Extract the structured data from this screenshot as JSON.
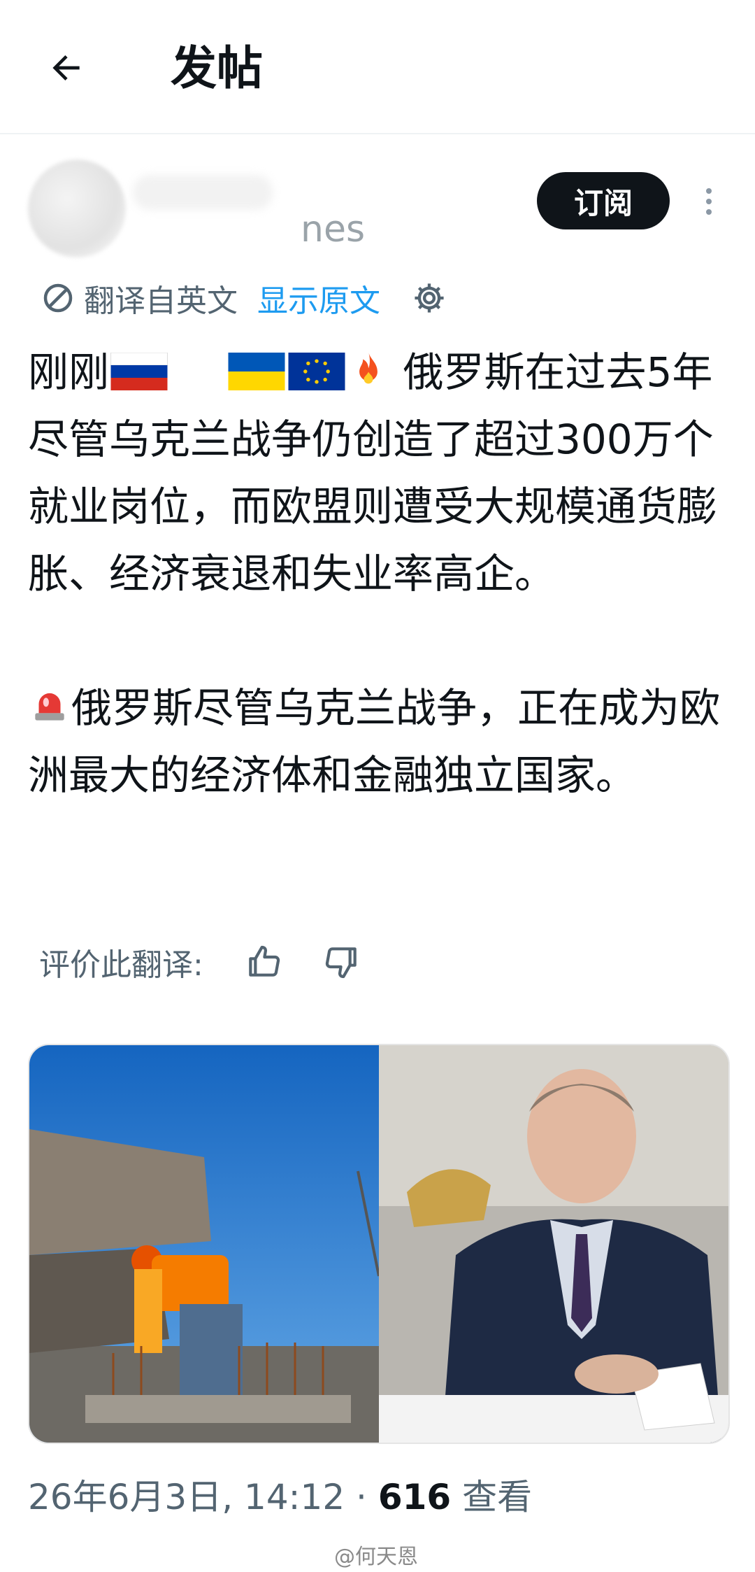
{
  "header": {
    "back_icon": "arrow-left-icon",
    "title": "发帖"
  },
  "author": {
    "handle_fragment": "nes",
    "subscribe_label": "订阅",
    "more_icon": "more-vertical-icon"
  },
  "translation": {
    "icon": "translate-icon",
    "label": "翻译自英文",
    "show_original": "显示原文",
    "settings_icon": "gear-icon"
  },
  "post": {
    "p1_lead": "刚刚",
    "p1_text": " 俄罗斯在过去5年尽管乌克兰战争仍创造了超过300万个就业岗位，而欧盟则遭受大规模通货膨胀、经济衰退和失业率高企。",
    "p2_text": "俄罗斯尽管乌克兰战争，正在成为欧洲最大的经济体和金融独立国家。",
    "emojis": [
      "russia-flag",
      "ukraine-flag",
      "eu-flag",
      "fire-emoji",
      "siren-emoji"
    ]
  },
  "rate": {
    "label": "评价此翻译:",
    "up_icon": "thumbs-up-icon",
    "down_icon": "thumbs-down-icon"
  },
  "media": {
    "left": "construction-worker-photo",
    "right": "man-in-suit-photo"
  },
  "meta": {
    "date": "26年6月3日, 14:12",
    "separator": " · ",
    "views_count": "616",
    "views_label": " 查看"
  },
  "watermark": "@何天恩",
  "colors": {
    "accent": "#1d9bf0",
    "text": "#0f1419",
    "muted": "#536471"
  }
}
